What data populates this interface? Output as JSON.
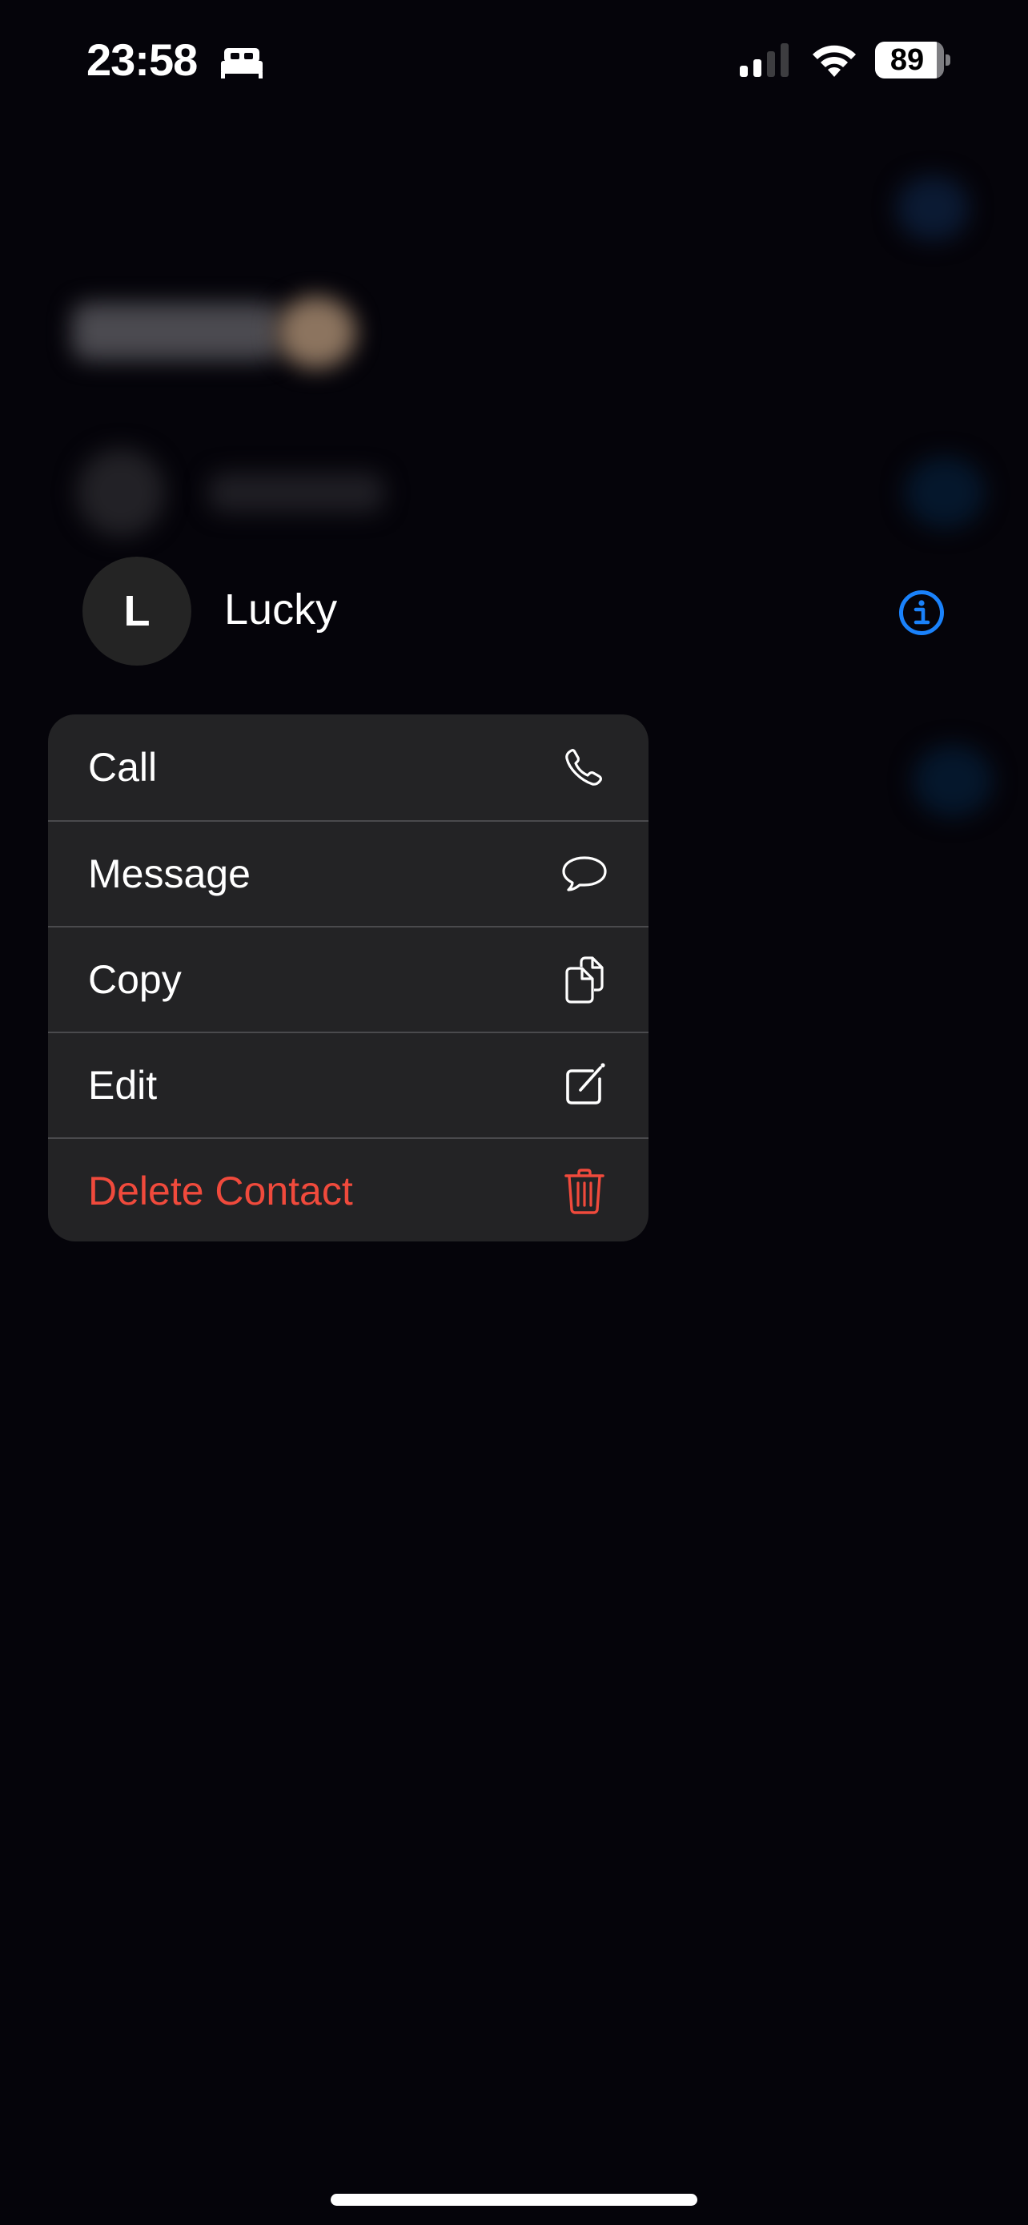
{
  "status_bar": {
    "time": "23:58",
    "focus_mode_icon": "bed-icon",
    "signal_icon": "cellular-signal-icon",
    "signal_bars_active": 2,
    "signal_bars_total": 4,
    "wifi_icon": "wifi-icon",
    "battery_percent": "89",
    "battery_level": 0.89
  },
  "contact": {
    "initial": "L",
    "name": "Lucky",
    "info_icon": "info-circle-icon"
  },
  "context_menu": {
    "items": [
      {
        "label": "Call",
        "icon": "phone-icon",
        "destructive": false
      },
      {
        "label": "Message",
        "icon": "message-bubble-icon",
        "destructive": false
      },
      {
        "label": "Copy",
        "icon": "copy-documents-icon",
        "destructive": false
      },
      {
        "label": "Edit",
        "icon": "edit-square-pencil-icon",
        "destructive": false
      },
      {
        "label": "Delete Contact",
        "icon": "trash-icon",
        "destructive": true
      }
    ]
  },
  "colors": {
    "background": "#05040a",
    "menu_background": "#232325",
    "divider": "#4a4a4d",
    "accent_blue": "#1a82fb",
    "destructive_red": "#f04a3c",
    "avatar_background": "#242424"
  }
}
